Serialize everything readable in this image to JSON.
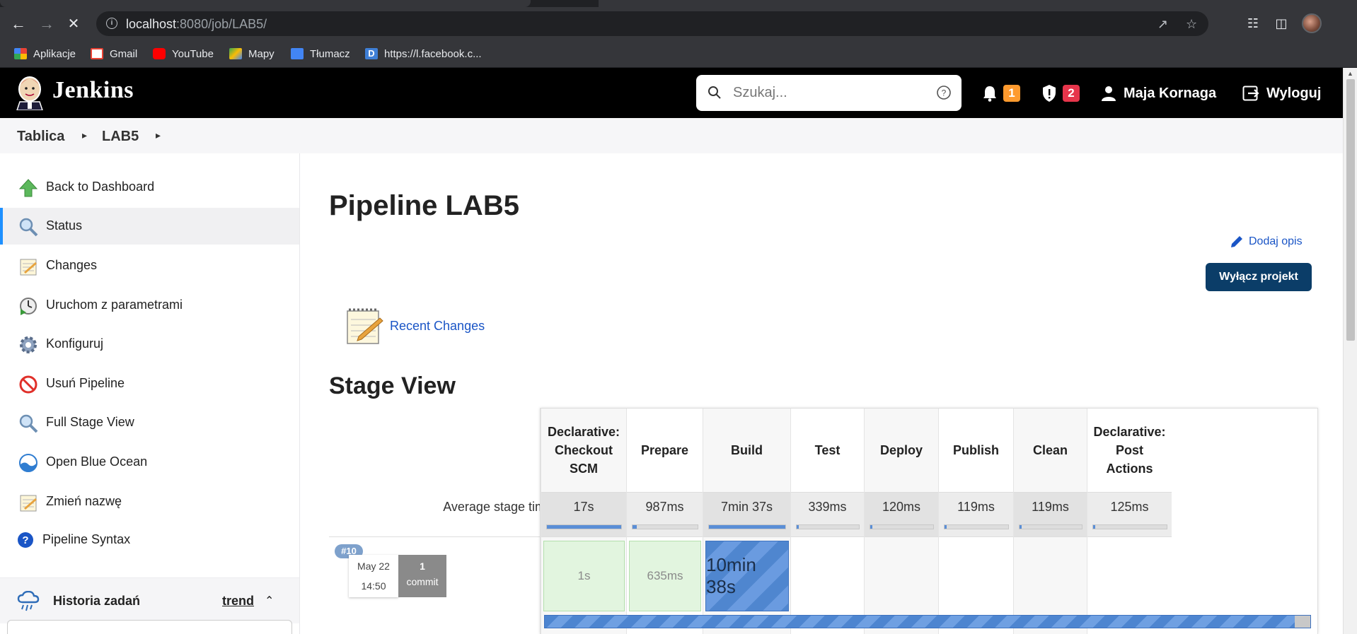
{
  "browser": {
    "url_host": "localhost",
    "url_rest": ":8080/job/LAB5/",
    "bookmarks": [
      {
        "label": "Aplikacje",
        "icon": "apps-grid-icon"
      },
      {
        "label": "Gmail",
        "icon": "gmail-icon"
      },
      {
        "label": "YouTube",
        "icon": "youtube-icon"
      },
      {
        "label": "Mapy",
        "icon": "maps-icon"
      },
      {
        "label": "Tłumacz",
        "icon": "translate-icon"
      },
      {
        "label": "https://l.facebook.c...",
        "icon": "d-letter-icon"
      }
    ]
  },
  "header": {
    "title": "Jenkins",
    "search_placeholder": "Szukaj...",
    "notifications_count": "1",
    "security_count": "2",
    "user_name": "Maja Kornaga",
    "logout_label": "Wyloguj"
  },
  "breadcrumb": [
    "Tablica",
    "LAB5"
  ],
  "sidebar": {
    "items": [
      {
        "label": "Back to Dashboard",
        "icon": "up-arrow-icon"
      },
      {
        "label": "Status",
        "icon": "magnifier-icon"
      },
      {
        "label": "Changes",
        "icon": "notepad-icon"
      },
      {
        "label": "Uruchom z parametrami",
        "icon": "clock-play-icon"
      },
      {
        "label": "Konfiguruj",
        "icon": "gear-icon"
      },
      {
        "label": "Usuń Pipeline",
        "icon": "no-entry-icon"
      },
      {
        "label": "Full Stage View",
        "icon": "magnifier-icon"
      },
      {
        "label": "Open Blue Ocean",
        "icon": "blue-ocean-icon"
      },
      {
        "label": "Zmień nazwę",
        "icon": "notepad-icon"
      },
      {
        "label": "Pipeline Syntax",
        "icon": "help-icon"
      }
    ],
    "history_title": "Historia zadań",
    "trend_label": "trend"
  },
  "main": {
    "title": "Pipeline LAB5",
    "edit_description": "Dodaj opis",
    "disable_button": "Wyłącz projekt",
    "recent_changes": "Recent Changes",
    "stage_view_title": "Stage View",
    "avg_label": "Average stage times:"
  },
  "stages": [
    {
      "name": "Declarative: Checkout SCM",
      "avg": "17s",
      "avg_fraction": 1.0,
      "cell": "1s",
      "status": "success"
    },
    {
      "name": "Prepare",
      "avg": "987ms",
      "avg_fraction": 0.06,
      "cell": "635ms",
      "status": "success"
    },
    {
      "name": "Build",
      "avg": "7min 37s",
      "avg_fraction": 1.0,
      "cell": "10min 38s",
      "status": "running"
    },
    {
      "name": "Test",
      "avg": "339ms",
      "avg_fraction": 0.02,
      "cell": "",
      "status": "empty"
    },
    {
      "name": "Deploy",
      "avg": "120ms",
      "avg_fraction": 0.02,
      "cell": "",
      "status": "empty"
    },
    {
      "name": "Publish",
      "avg": "119ms",
      "avg_fraction": 0.02,
      "cell": "",
      "status": "empty"
    },
    {
      "name": "Clean",
      "avg": "119ms",
      "avg_fraction": 0.02,
      "cell": "",
      "status": "empty"
    },
    {
      "name": "Declarative: Post Actions",
      "avg": "125ms",
      "avg_fraction": 0.02,
      "cell": "",
      "status": "empty"
    }
  ],
  "build": {
    "number": "#10",
    "date": "May 22",
    "time": "14:50",
    "commit_count": "1",
    "commit_label": "commit",
    "progress_fraction": 0.98
  },
  "colors": {
    "header_bg": "#000000",
    "accent": "#1e90ff",
    "disable_btn": "#0b3d68",
    "success_cell": "#e2f5df",
    "running_cell": "#4f86cf"
  }
}
